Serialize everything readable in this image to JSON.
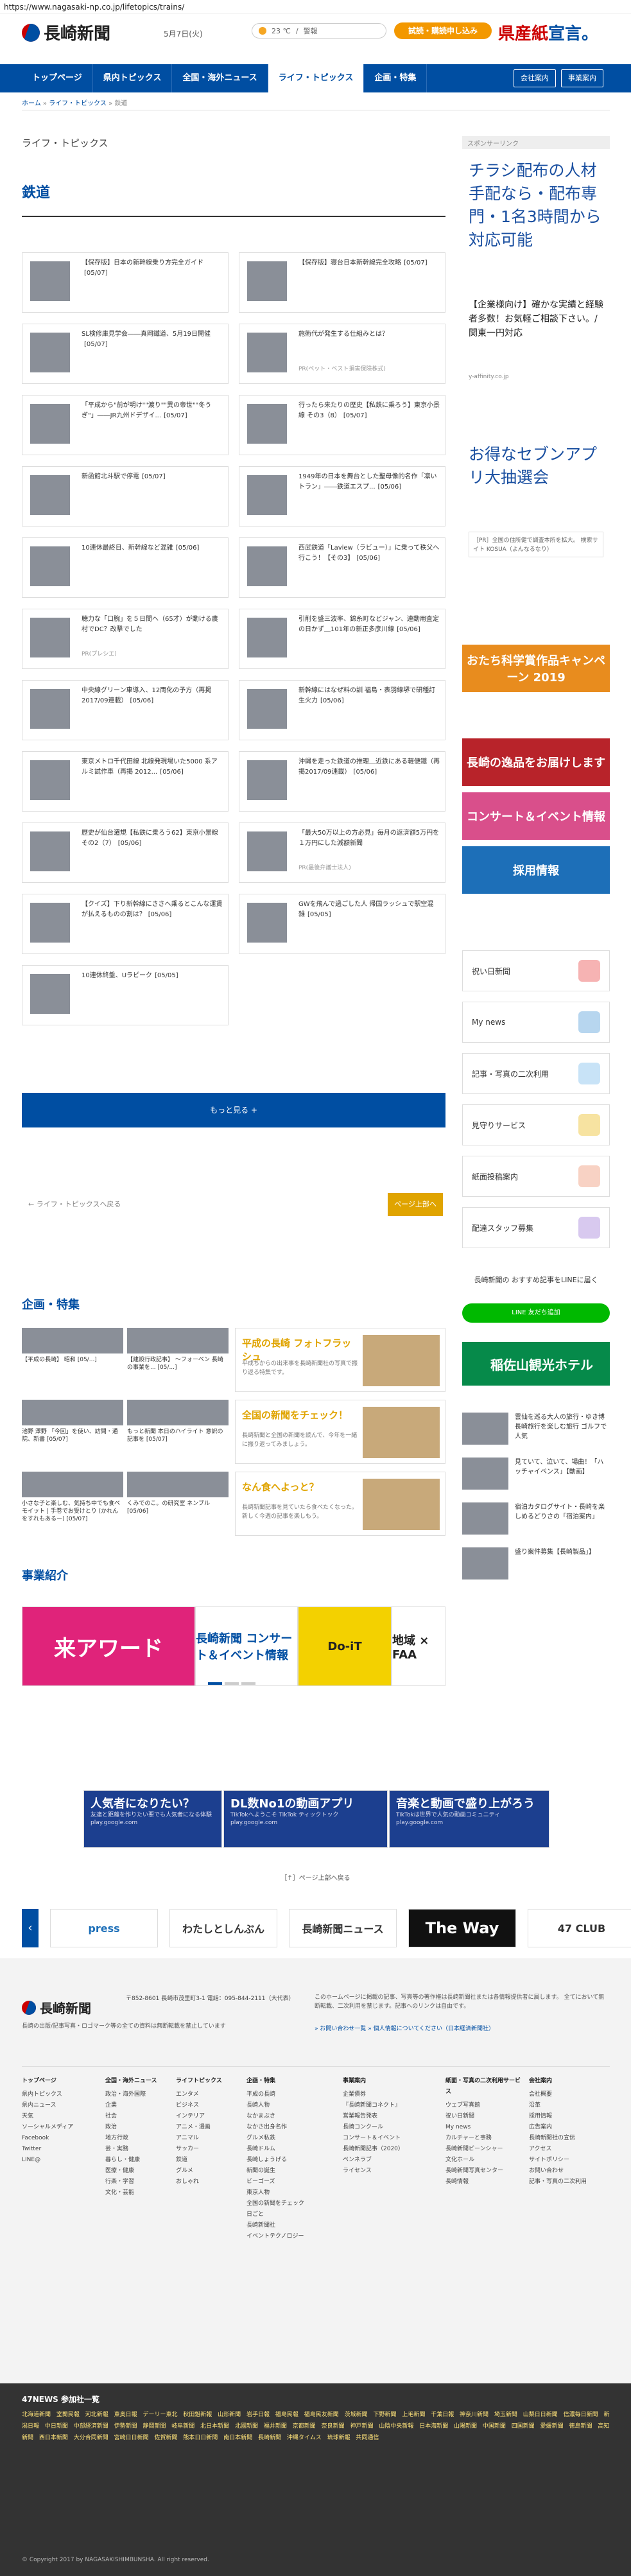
{
  "url": "https://www.nagasaki-np.co.jp/lifetopics/trains/",
  "header": {
    "logo_text": "長崎新聞",
    "date": "5月7日(火)",
    "weather_temp": "23 ℃",
    "weather_sep": "/",
    "weather_link": "警報",
    "trial_btn": "試読・購読申し込み",
    "banner_a": "県産",
    "banner_b": "紙",
    "banner_c": "宣言。"
  },
  "nav": {
    "items": [
      "トップページ",
      "県内トピックス",
      "全国・海外ニュース",
      "ライフ・トピックス",
      "企画・特集"
    ],
    "active": 3,
    "company": "会社案内",
    "business": "事業案内"
  },
  "breadcrumb": {
    "home": "ホーム",
    "sep": " » ",
    "life": "ライフ・トピックス",
    "here": "鉄道"
  },
  "section_title": "ライフ・トピックス",
  "category_title": "鉄道",
  "articles": [
    {
      "title": "【保存版】日本の新幹線乗り方完全ガイド",
      "date": "[05/07]",
      "sub": ""
    },
    {
      "title": "【保存版】寝台日本新幹線完全攻略",
      "date": "[05/07]",
      "sub": ""
    },
    {
      "title": "SL検修庫見学会――真岡鐵道、5月19日開催",
      "date": "[05/07]",
      "sub": ""
    },
    {
      "title": "施術代が発生する仕組みとは？",
      "date": "",
      "sub": "PR(ペット・ベスト損害保険株式)"
    },
    {
      "title": "「平成から\"前が明け\"\"渡り\"\"異の帝世\"\"冬うぎ\"」――JR九州ドデザイ...",
      "date": "[05/07]",
      "sub": ""
    },
    {
      "title": "行ったら来たりの歴史【私鉄に乗ろう】東京小景線 その3（8）",
      "date": "[05/07]",
      "sub": ""
    },
    {
      "title": "新函館北斗駅で停電",
      "date": "[05/07]",
      "sub": ""
    },
    {
      "title": "1949年の日本を舞台とした聖母像的名作「凛いトラン」――鉄道エスプ...",
      "date": "[05/06]",
      "sub": ""
    },
    {
      "title": "10連休最終日、新幹線など混雑",
      "date": "[05/06]",
      "sub": ""
    },
    {
      "title": "西武鉄道「Laview（ラビュー）」に乗って秩父へ行こう！【その3】",
      "date": "[05/06]",
      "sub": ""
    },
    {
      "title": "聴力な「口腕」を５日間へ（65才）が動ける農村でDC？改撃でした",
      "date": "",
      "sub": "PR(プレシエ)"
    },
    {
      "title": "引削を盛三波率、錦糸町などジャン、連動用査定の日かず＿101年の新正多彦川線",
      "date": "[05/06]",
      "sub": ""
    },
    {
      "title": "中央線グリーン車導入、12両化の予方（再掲2017/09連載）",
      "date": "[05/06]",
      "sub": ""
    },
    {
      "title": "新幹線にはなぜ料の訓 福島・表羽線堺で研種訂生火力",
      "date": "[05/06]",
      "sub": ""
    },
    {
      "title": "東京メトロ千代田線 北線発現場いた5000 系アルミ試作車（再掲 2012...",
      "date": "[05/06]",
      "sub": ""
    },
    {
      "title": "沖縄を走った鉄道の推理＿近鉄にある軽便鐵（再掲2017/09連載）",
      "date": "[05/06]",
      "sub": ""
    },
    {
      "title": "歴史が仙台遷規【私鉄に乗ろう62】東京小景線 その2（7）",
      "date": "[05/06]",
      "sub": ""
    },
    {
      "title": "「最大50万以上の方必見」毎月の返済額5万円を１万円にした減額新聞",
      "date": "",
      "sub": "PR(最後弁護士法人)"
    },
    {
      "title": "【クイズ】下り新幹線にささへ乗るとこんな運賃が払えるものの割は？",
      "date": "[05/06]",
      "sub": ""
    },
    {
      "title": "GWを飛んで過ごした人 帰国ラッシュで駅空混雑",
      "date": "[05/05]",
      "sub": ""
    },
    {
      "title": "10連休終盤、Uラピーク",
      "date": "[05/05]",
      "sub": ""
    }
  ],
  "more_btn": "もっと見る +",
  "back_link": "← ライフ・トピックスへ戻る",
  "pagetop_btn": "ページ上部へ",
  "sidebar": {
    "sponsor_label": "スポンサーリンク",
    "ad1_title": "チラシ配布の人材手配なら・配布専門・1名3時間から対応可能",
    "ad1_sub": "【企業様向け】確かな実績と経験者多数！お気軽ご相談下さい。/ 関東一円対応",
    "ad1_url": "y-affinity.co.jp",
    "ad2_title": "お得なセブンアプリ大抽選会",
    "ad3": "［PR］全国の住所健で調査本所を拡大。 検索サイト KOSUA（よんなるなり）",
    "banners": [
      {
        "text": "おたち科学賞作品キャンペーン 2019",
        "color": "#e88c1e"
      },
      {
        "text": "長崎の逸品をお届けします",
        "color": "#b8232a"
      },
      {
        "text": "コンサート＆イベント情報",
        "color": "#d94f8b"
      },
      {
        "text": "採用情報",
        "color": "#1d6fb8"
      }
    ],
    "boxes": [
      {
        "label": "祝い日新聞",
        "color": "#f6b3b3"
      },
      {
        "label": "My news",
        "color": "#b7d6ef"
      },
      {
        "label": "記事・写真の二次利用",
        "color": "#c8e3f7"
      },
      {
        "label": "見守りサービス",
        "color": "#f7e3a1"
      },
      {
        "label": "紙面投稿案内",
        "color": "#f8d2c4"
      },
      {
        "label": "配達スタッフ募集",
        "color": "#d8c9ef"
      }
    ],
    "line_head": "長崎新聞の おすすめ記事をLINEに届く",
    "line_btn": "LINE 友だち追加",
    "hotel": "稲佐山観光ホテル",
    "side_list": [
      "雲仙を巡る大人の旅行・ゆき博 長崎旅行を楽しむ旅行 ゴルフで人気",
      "見ていて、泣いて、場曲！「ハッチャイペンス」【動画】",
      "宿泊カタログサイト・長崎を楽しめるどりさの「宿泊案内」",
      "盛り案件募集【長崎製品」】"
    ]
  },
  "feature": {
    "heading": "企画・特集",
    "cells": [
      {
        "title": "平成の長崎 フォトフラッシュ",
        "desc": "平成ちからの出来事を長崎新聞社の写真で振り返る特集です。"
      },
      {
        "title": "全国の新聞をチェック！",
        "desc": "長崎新聞と全国の新聞を読んで、今年を一緒に振り返ってみましょう。"
      },
      {
        "title": "なん食へよっと？",
        "desc": "長崎新聞記事を見ていたら食べたくなった。新しく今週の記事を楽しもう。"
      }
    ],
    "captions": [
      "【平成の長崎】 昭和 [05/...]",
      "【建設行政記事】 ～フォーベン 長崎の事業を... [05/...]",
      "池野 澤野 「今回」を使い、訪問・通院、新書 [05/07]",
      "もっと新聞 本日のハイライト 意訳の記事を [05/07]",
      "小さな子と楽しむ、気持ち中でも食ベモイット | 手巻でお受けとり (かれんをすれもあるー) [05/07]",
      "くみでのこ。の研究室 ネンブル [05/06]"
    ]
  },
  "biz": {
    "heading": "事業紹介",
    "items": [
      {
        "text": "来アワード",
        "bg": "#e0237a",
        "fg": "#fff"
      },
      {
        "text": "長崎新聞 コンサート＆イベント情報",
        "bg": "#fff",
        "fg": "#004ea2"
      },
      {
        "text": "Do-iT",
        "bg": "#f3d100",
        "fg": "#222"
      },
      {
        "text": "地域 × FAA",
        "bg": "#fff",
        "fg": "#222"
      }
    ]
  },
  "google_ads": [
    {
      "title": "人気者になりたい？",
      "desc": "友達と距離を作りたい悪でも人気者になる体験 play.google.com"
    },
    {
      "title": "DL数No1の動画アプリ",
      "desc": "TikTokへようこそ TikTok ティックトック play.google.com"
    },
    {
      "title": "音楽と動画で盛り上がろう",
      "desc": "TikTokは世界で人気の動画コミュニティ play.google.com"
    }
  ],
  "close_ad": "［↑］ページ上部へ戻る",
  "carousel": [
    "press",
    "わたしとしんぶん",
    "長崎新聞ニュース",
    "The Way",
    "47 CLUB"
  ],
  "footer": {
    "logo_text": "長崎新聞",
    "addr": "〒852-8601 長崎市茂里町3-1 電話：095-844-2111（大代表）",
    "note": "長崎の出版/記事写真・ロゴマーク等の全ての資料は無断転載を禁止しています",
    "copyright_note": "このホームページに掲載の記事、写真等の著作権は長崎新聞社または各情報提供者に属します。 全てにおいて無断転載、二次利用を禁じます。記事へのリンクは自由です。",
    "links": "» お問い合わせ一覧    » 個人情報についてください（日本経済新聞社）",
    "cols": [
      {
        "head": "トップページ",
        "items": [
          "県内トピックス",
          "県内ニュース",
          "天気",
          "ソーシャルメディア",
          "Facebook",
          "Twitter",
          "LINE@"
        ]
      },
      {
        "head": "全国・海外ニュース",
        "items": [
          "政治・海外国際",
          "企業",
          "社会",
          "政治",
          "地方行政",
          "芸・実務",
          "暮らし・健康",
          "医療・健康",
          "行楽・学習",
          "文化・芸能"
        ]
      },
      {
        "head": "ライフトピックス",
        "items": [
          "エンタメ",
          "ビジネス",
          "インテリア",
          "アニメ・漫画",
          "アニマル",
          "サッカー",
          "鉄道",
          "グルメ",
          "おしゃれ"
        ]
      },
      {
        "head": "企画・特集",
        "items": [
          "平成の長崎",
          "長崎人物",
          "なかまぶき",
          "なかさ出身名作",
          "グルメ私鉄",
          "長崎ドルム",
          "長崎しょうげる",
          "新聞の誕生",
          "ビーゴーズ",
          "東京人物",
          "全国の新聞をチェック",
          "日ごと",
          "長崎新聞社",
          "イベントテクノロジー"
        ]
      },
      {
        "head": "事業案内",
        "items": [
          "企業債券",
          "『長崎新聞コネクト』",
          "営業報告発表",
          "長崎コンクール",
          "コンサート＆イベント",
          "長崎新聞記事（2020）",
          "ペンネラブ",
          "ライセンス"
        ]
      },
      {
        "head": "紙面・写真の二次利用サービス",
        "items": [
          "ウェブ写真館",
          "祝い日新聞",
          "My news",
          "カルチャーと事務",
          "長崎新聞ピーンシャー",
          "文化ホール",
          "長崎新聞写真センター",
          "長崎情報"
        ]
      },
      {
        "head": "会社案内",
        "items": [
          "会社概要",
          "沿革",
          "採用情報",
          "広告案内",
          "長崎新聞社の宣伝",
          "アクセス",
          "サイトポリシー",
          "お問い合わせ",
          "記事・写真の二次利用"
        ]
      }
    ]
  },
  "news47": {
    "heading": "47NEWS 参加社一覧",
    "list": "北海道新聞 室蘭民報 河北新報 東奥日報 デーリー東北 秋田魁新報 山形新聞 岩手日報 福島民報 福島民友新聞 茨城新聞 下野新聞 上毛新聞 千葉日報 神奈川新聞 埼玉新聞 山梨日日新聞 信濃毎日新聞 新潟日報 中日新聞 中部経済新聞 伊勢新聞 静岡新聞 岐阜新聞 北日本新聞 北國新聞 福井新聞 京都新聞 奈良新聞 神戸新聞 山陰中央新報 日本海新聞 山陽新聞 中国新聞 四国新聞 愛媛新聞 徳島新聞 高知新聞 西日本新聞 大分合同新聞 宮崎日日新聞 佐賀新聞 熊本日日新聞 南日本新聞 長崎新聞 沖縄タイムス 琉球新報 共同通信",
    "copyright": "© Copyright 2017 by NAGASAKISHIMBUNSHA. All right reserved."
  },
  "colors": {
    "brand": "#004ea2",
    "accent": "#e0a400",
    "trial": "#f39800"
  }
}
